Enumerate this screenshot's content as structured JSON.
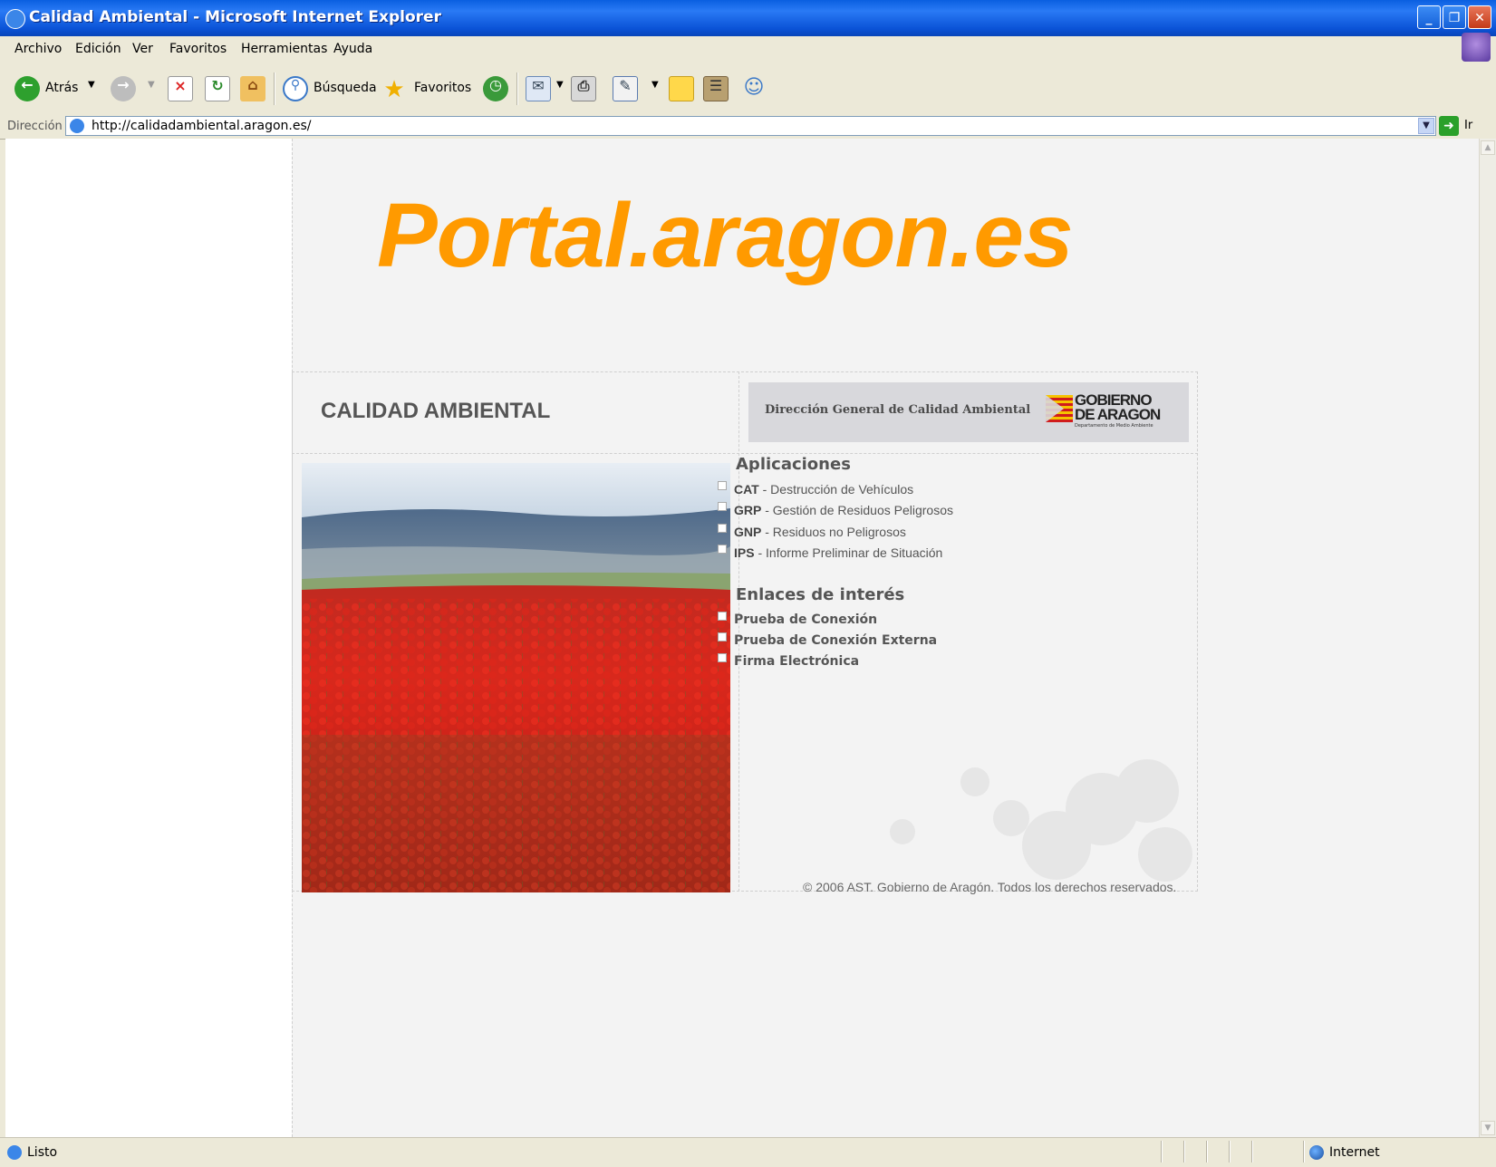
{
  "window": {
    "title": "Calidad Ambiental - Microsoft Internet Explorer",
    "buttons": {
      "minimize": "_",
      "restore": "❐",
      "close": "✕"
    }
  },
  "menubar": {
    "items": [
      {
        "label": "Archivo"
      },
      {
        "label": "Edición"
      },
      {
        "label": "Ver"
      },
      {
        "label": "Favoritos"
      },
      {
        "label": "Herramientas"
      },
      {
        "label": "Ayuda"
      }
    ]
  },
  "toolbar": {
    "back_label": "Atrás",
    "search_label": "Búsqueda",
    "favorites_label": "Favoritos"
  },
  "address": {
    "label": "Dirección",
    "url": "http://calidadambiental.aragon.es/",
    "go_label": "Ir"
  },
  "page": {
    "banner_title": "Portal.aragon.es",
    "section_title": "CALIDAD AMBIENTAL",
    "gov_banner": {
      "text": "Dirección General de Calidad Ambiental",
      "logo_line1": "GOBIERNO",
      "logo_line2": "DE ARAGON",
      "logo_subtitle": "Departamento de Medio Ambiente"
    },
    "applications": {
      "heading": "Aplicaciones",
      "items": [
        {
          "abbr": "CAT",
          "label": " - Destrucción de Vehículos"
        },
        {
          "abbr": "GRP",
          "label": " - Gestión de Residuos Peligrosos"
        },
        {
          "abbr": "GNP",
          "label": " - Residuos no Peligrosos"
        },
        {
          "abbr": "IPS",
          "label": " - Informe Preliminar de Situación"
        }
      ]
    },
    "links": {
      "heading": "Enlaces de interés",
      "items": [
        {
          "label": "Prueba de Conexión"
        },
        {
          "label": "Prueba de Conexión Externa"
        },
        {
          "label": "Firma Electrónica"
        }
      ]
    },
    "copyright": "© 2006 AST. Gobierno de Aragón. Todos los derechos reservados."
  },
  "statusbar": {
    "text": "Listo",
    "zone": "Internet"
  },
  "colors": {
    "banner_orange": "#ff9a00",
    "xp_blue": "#0a5fe0",
    "page_bg": "#f3f3f3",
    "poppy_red": "#e3211b"
  }
}
